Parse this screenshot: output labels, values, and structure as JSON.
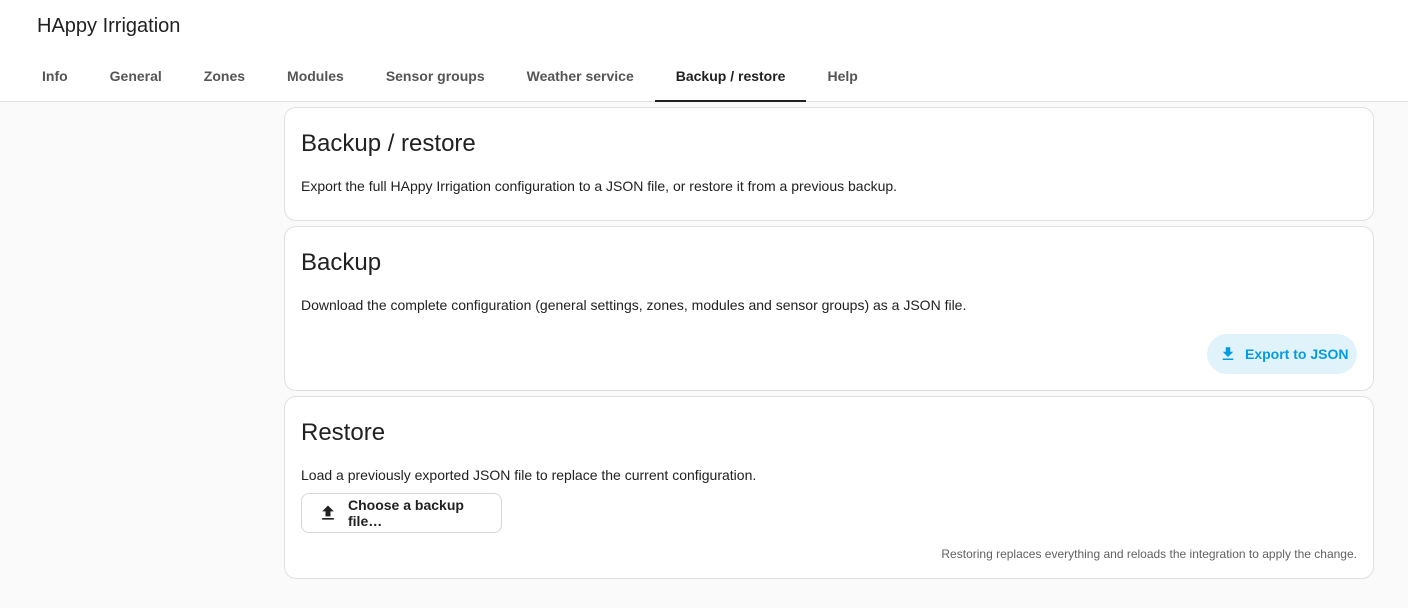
{
  "app": {
    "title": "HAppy Irrigation"
  },
  "tabs": [
    {
      "label": "Info",
      "active": false
    },
    {
      "label": "General",
      "active": false
    },
    {
      "label": "Zones",
      "active": false
    },
    {
      "label": "Modules",
      "active": false
    },
    {
      "label": "Sensor groups",
      "active": false
    },
    {
      "label": "Weather service",
      "active": false
    },
    {
      "label": "Backup / restore",
      "active": true
    },
    {
      "label": "Help",
      "active": false
    }
  ],
  "intro": {
    "title": "Backup / restore",
    "description": "Export the full HAppy Irrigation configuration to a JSON file, or restore it from a previous backup."
  },
  "backup": {
    "title": "Backup",
    "description": "Download the complete configuration (general settings, zones, modules and sensor groups) as a JSON file.",
    "button_label": "Export to JSON",
    "button_icon": "download-icon"
  },
  "restore": {
    "title": "Restore",
    "description": "Load a previously exported JSON file to replace the current configuration.",
    "button_label": "Choose a backup file…",
    "button_icon": "upload-icon",
    "note": "Restoring replaces everything and reloads the integration to apply the change."
  },
  "colors": {
    "accent": "#039be5",
    "accent_bg": "#e1f3fa",
    "active_tab": "#212121"
  }
}
